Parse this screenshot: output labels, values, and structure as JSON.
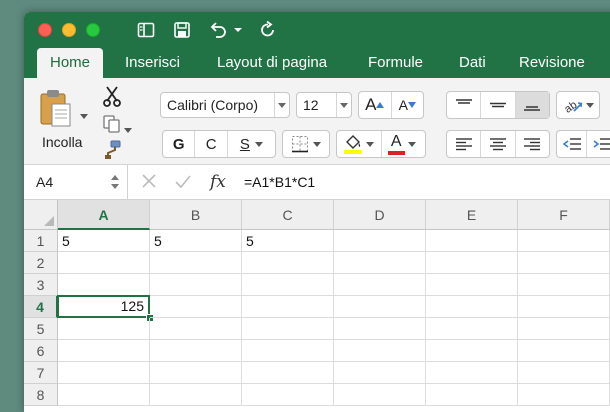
{
  "colors": {
    "accent": "#217346",
    "ribbon_bg": "#f3f3f3",
    "highlight_yellow": "#ffff00",
    "font_red": "#e02020"
  },
  "tabs": [
    {
      "label": "Home",
      "active": true
    },
    {
      "label": "Inserisci"
    },
    {
      "label": "Layout di pagina"
    },
    {
      "label": "Formule"
    },
    {
      "label": "Dati"
    },
    {
      "label": "Revisione"
    }
  ],
  "ribbon": {
    "paste_label": "Incolla",
    "font_name": "Calibri (Corpo)",
    "font_size": "12",
    "grow_font": "A",
    "shrink_font": "A",
    "bold": "G",
    "italic": "C",
    "underline": "S",
    "highlight_glyph": "",
    "font_color_glyph": "A"
  },
  "formula_bar": {
    "name_box": "A4",
    "fx_label": "fx",
    "formula": "=A1*B1*C1"
  },
  "sheet": {
    "columns": [
      "A",
      "B",
      "C",
      "D",
      "E",
      "F"
    ],
    "rows": [
      "1",
      "2",
      "3",
      "4",
      "5",
      "6",
      "7",
      "8"
    ],
    "cells": {
      "A1": "5",
      "B1": "5",
      "C1": "5",
      "A4": "125"
    },
    "active_cell": "A4"
  }
}
